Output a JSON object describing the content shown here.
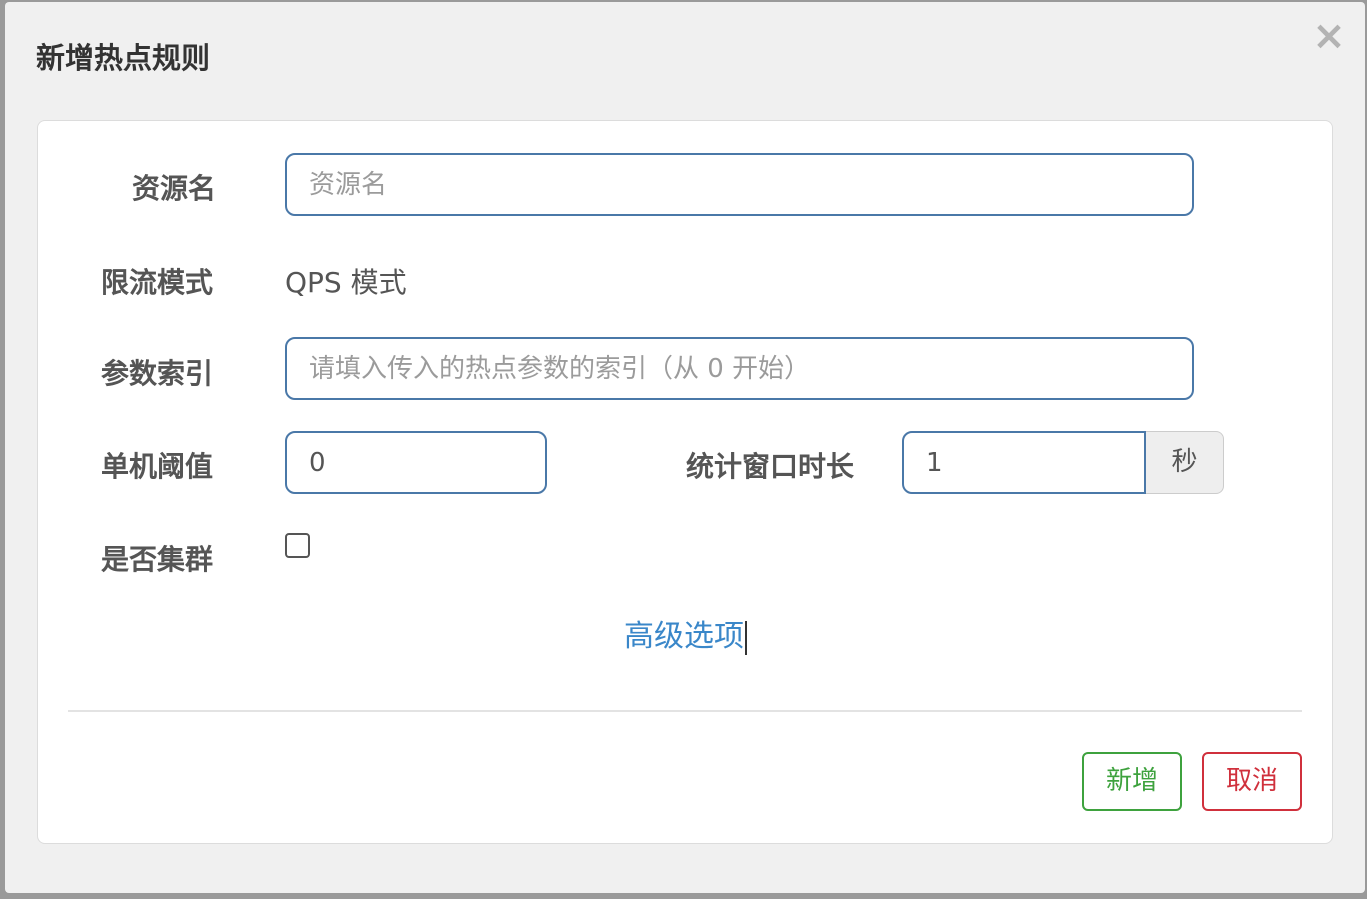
{
  "modal": {
    "title": "新增热点规则",
    "close_glyph": "×"
  },
  "form": {
    "resource": {
      "label": "资源名",
      "value": "",
      "placeholder": "资源名"
    },
    "limit_mode": {
      "label": "限流模式",
      "value": "QPS 模式"
    },
    "param_index": {
      "label": "参数索引",
      "value": "",
      "placeholder": "请填入传入的热点参数的索引（从 0 开始）"
    },
    "threshold": {
      "label": "单机阈值",
      "value": "0"
    },
    "stat_window": {
      "label": "统计窗口时长",
      "value": "1",
      "unit": "秒"
    },
    "cluster": {
      "label": "是否集群",
      "checked": false
    },
    "advanced_link": "高级选项"
  },
  "footer": {
    "add_label": "新增",
    "cancel_label": "取消"
  },
  "colors": {
    "input_border": "#4a78a8",
    "link": "#3a87c9",
    "add": "#3ea23e",
    "cancel": "#d0303c"
  }
}
